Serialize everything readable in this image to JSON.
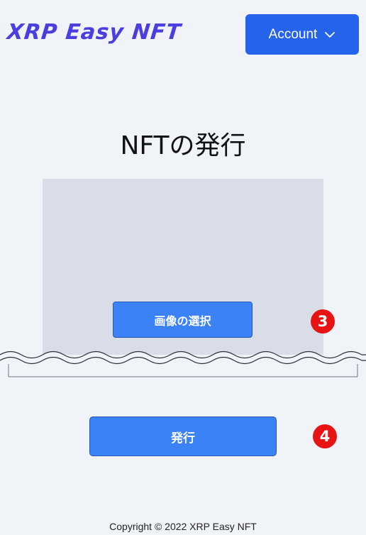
{
  "header": {
    "logo_text": "XRP Easy NFT",
    "account_label": "Account"
  },
  "main": {
    "title": "NFTの発行",
    "select_image_label": "画像の選択",
    "issue_label": "発行"
  },
  "badges": {
    "step_3": "3",
    "step_4": "4"
  },
  "footer": {
    "copyright": "Copyright © 2022 XRP Easy NFT"
  },
  "colors": {
    "background": "#f0f4f9",
    "logo": "#4b3ee0",
    "primary_button": "#2563eb",
    "button": "#3b82f6",
    "image_placeholder": "#d8dde8",
    "badge": "#e81414"
  },
  "icons": {
    "account_dropdown": "chevron-down-icon"
  }
}
